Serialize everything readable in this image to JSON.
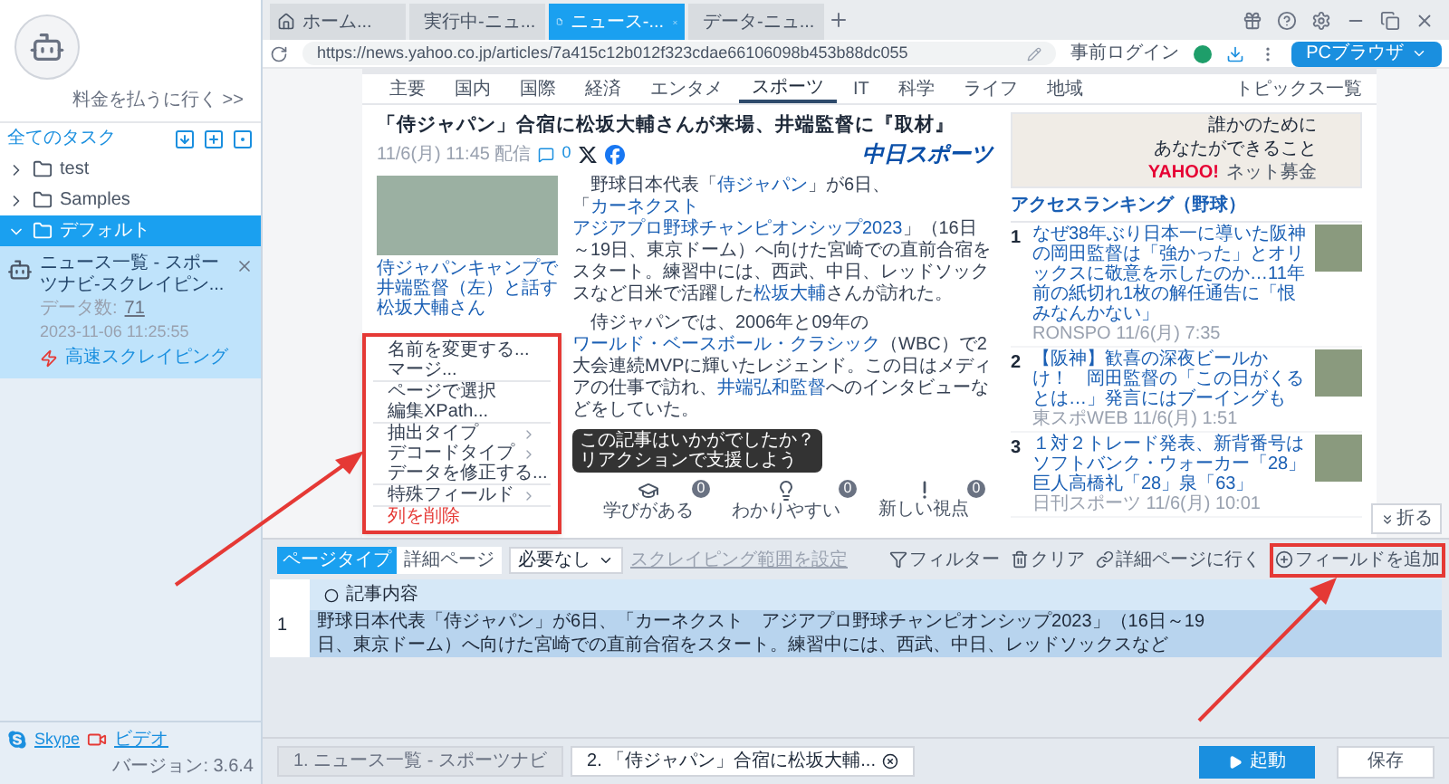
{
  "sidebar": {
    "upgrade_link": "料金を払うに行く >>",
    "all_tasks_label": "全てのタスク",
    "folders": [
      {
        "name": "test",
        "expanded": false,
        "selected": false
      },
      {
        "name": "Samples",
        "expanded": false,
        "selected": false
      },
      {
        "name": "デフォルト",
        "expanded": true,
        "selected": true,
        "tasks": [
          {
            "name": "ニュース一覧 - スポーツナビ-スクレイピン...",
            "count_label": "データ数:",
            "count": "71",
            "time": "2023-11-06 11:25:55",
            "mode": "高速スクレイピング"
          }
        ]
      }
    ],
    "footer": {
      "skype": "Skype",
      "video": "ビデオ",
      "version": "バージョン: 3.6.4"
    }
  },
  "browser_tabs": [
    {
      "label": "ホーム...",
      "kind": "home",
      "selected": false
    },
    {
      "label": "実行中-ニュ...",
      "kind": "page",
      "selected": false
    },
    {
      "label": "ニュース-...",
      "kind": "page",
      "selected": true
    },
    {
      "label": "データ-ニュ...",
      "kind": "page",
      "selected": false
    }
  ],
  "address_bar": {
    "url": "https://news.yahoo.co.jp/articles/7a415c12b012f323cdae66106098b453b88dc055",
    "login_label": "事前ログイン",
    "browser_button": "PCブラウザ"
  },
  "webpage": {
    "nav": [
      {
        "label": "主要",
        "selected": false
      },
      {
        "label": "国内",
        "selected": false
      },
      {
        "label": "国際",
        "selected": false
      },
      {
        "label": "経済",
        "selected": false
      },
      {
        "label": "エンタメ",
        "selected": false
      },
      {
        "label": "スポーツ",
        "selected": true
      },
      {
        "label": "IT",
        "selected": false
      },
      {
        "label": "科学",
        "selected": false
      },
      {
        "label": "ライフ",
        "selected": false
      },
      {
        "label": "地域",
        "selected": false
      }
    ],
    "topics_link": "トピックス一覧",
    "article": {
      "title": "「侍ジャパン」合宿に松坂大輔さんが来場、井端監督に『取材』",
      "date": "11/6(月) 11:45 配信",
      "comment_count": "0",
      "source_logo": "中日スポーツ",
      "photo_caption": "侍ジャパンキャンプで井端監督（左）と話す松坂大輔さん",
      "paragraphs": [
        [
          {
            "text": "野球日本代表「",
            "link": false
          },
          {
            "text": "侍ジャパン",
            "link": true
          },
          {
            "text": "」が6日、「",
            "link": false
          },
          {
            "text": "カーネクスト",
            "link": true
          },
          {
            "text": "アジアプロ野球チャンピオンシップ2023",
            "link": true
          },
          {
            "text": "」（16日～19日、東京ドーム）へ向けた宮崎での直前合宿をスタート。練習中には、西武、中日、レッドソックスなど日米で活躍した",
            "link": false
          },
          {
            "text": "松坂大輔",
            "link": true
          },
          {
            "text": "さんが訪れた。",
            "link": false
          }
        ],
        [
          {
            "text": "侍ジャパンでは、2006年と09年の",
            "link": false
          },
          {
            "text": "ワールド・ベースボール・クラシック",
            "link": true
          },
          {
            "text": "（WBC）で2大会連続MVPに輝いたレジェンド。この日はメディアの仕事で訪れ、",
            "link": false
          },
          {
            "text": "井端弘和監督",
            "link": true
          },
          {
            "text": "へのインタビューなどをしていた。",
            "link": false
          }
        ]
      ],
      "reaction_prompt": [
        "この記事はいかがでしたか？",
        "リアクションで支援しよう"
      ],
      "reactions": [
        {
          "kind": "learn",
          "label": "学びがある",
          "count": "0"
        },
        {
          "kind": "clear",
          "label": "わかりやすい",
          "count": "0"
        },
        {
          "kind": "new",
          "label": "新しい視点",
          "count": "0"
        }
      ]
    },
    "ad": {
      "line1": "誰かのために",
      "line2": "あなたができること",
      "brand": "YAHOO!",
      "service": "ネット募金"
    },
    "ranking": {
      "title": "アクセスランキング（野球）",
      "items": [
        {
          "rank": "1",
          "title": "なぜ38年ぶり日本一に導いた阪神の岡田監督は「強かった」とオリックスに敬意を示したのか…11年前の紙切れ1枚の解任通告に「恨みなんかない」",
          "source": "RONSPO 11/6(月) 7:35"
        },
        {
          "rank": "2",
          "title": "【阪神】歓喜の深夜ビールかけ！　岡田監督の「この日がくるとは…」発言にはブーイングも",
          "source": "東スポWEB 11/6(月) 1:51"
        },
        {
          "rank": "3",
          "title": "１対２トレード発表、新背番号はソフトバンク・ウォーカー「28」巨人高橋礼「28」泉「63」",
          "source": "日刊スポーツ 11/6(月) 10:01"
        }
      ]
    },
    "collapse_button": "折る"
  },
  "context_menu": [
    {
      "label": "名前を変更する...",
      "kind": "item",
      "divider_after": false
    },
    {
      "label": "マージ...",
      "kind": "item",
      "divider_after": true
    },
    {
      "label": "ページで選択",
      "kind": "item",
      "divider_after": false
    },
    {
      "label": "編集XPath...",
      "kind": "item",
      "divider_after": true
    },
    {
      "label": "抽出タイプ",
      "kind": "submenu",
      "divider_after": false
    },
    {
      "label": "デコードタイプ",
      "kind": "submenu",
      "divider_after": false
    },
    {
      "label": "データを修正する...",
      "kind": "item",
      "divider_after": true
    },
    {
      "label": "特殊フィールド",
      "kind": "submenu",
      "divider_after": true
    },
    {
      "label": "列を削除",
      "kind": "danger",
      "divider_after": false
    }
  ],
  "panel": {
    "page_type_label": "ページタイプ",
    "page_type_value": "詳細ページ",
    "dropdown_value": "必要なし",
    "scrape_range_link": "スクレイピング範囲を設定",
    "actions": [
      {
        "kind": "filter",
        "label": "フィルター"
      },
      {
        "kind": "clear",
        "label": "クリア"
      },
      {
        "kind": "goto",
        "label": "詳細ページに行く"
      },
      {
        "kind": "add",
        "label": "フィールドを追加"
      }
    ],
    "columns": [
      "記事内容"
    ],
    "rows": [
      {
        "index": "1",
        "selected": true,
        "cells": [
          "野球日本代表「侍ジャパン」が6日、「カーネクスト　アジアプロ野球チャンピオンシップ2023」（16日～19日、東京ドーム）へ向けた宮崎での直前合宿をスタート。練習中には、西武、中日、レッドソックスなど"
        ]
      }
    ]
  },
  "step_tabs": [
    {
      "label": "1. ニュース一覧 - スポーツナビ",
      "selected": false,
      "closable": false
    },
    {
      "label": "2. 「侍ジャパン」合宿に松坂大輔...",
      "selected": true,
      "closable": true
    }
  ],
  "start_button": "起動",
  "save_button": "保存"
}
